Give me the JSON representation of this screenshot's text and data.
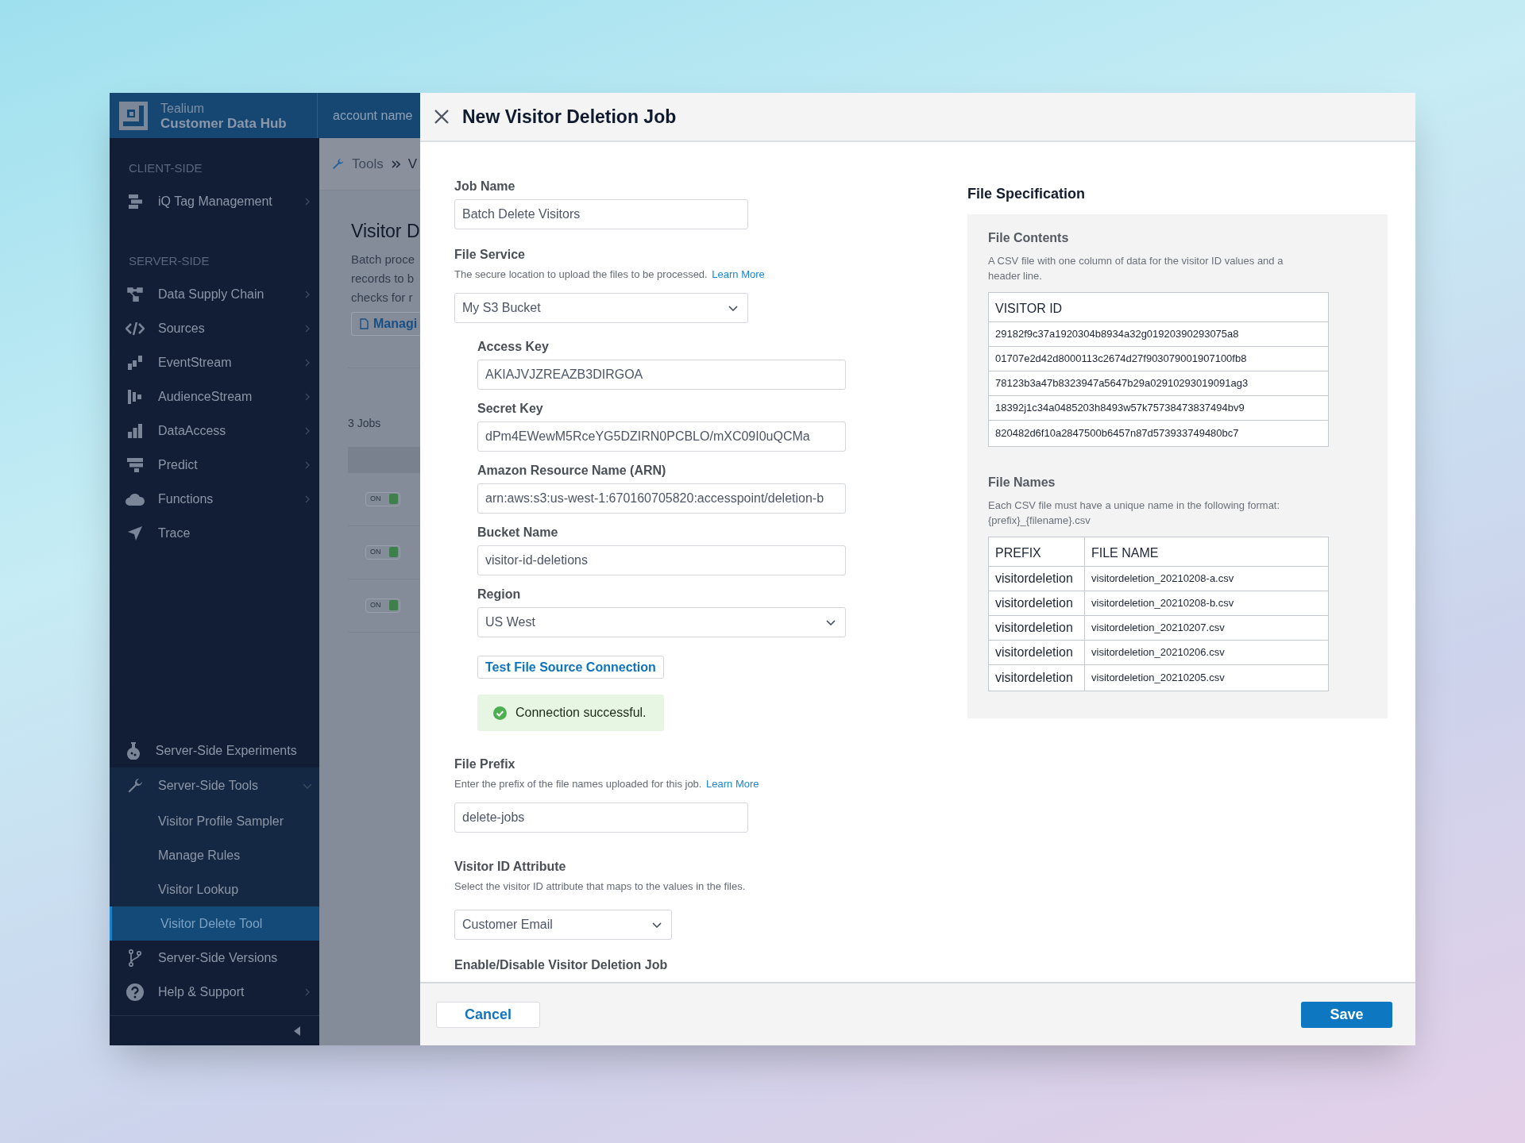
{
  "header": {
    "brand_top": "Tealium",
    "brand_bottom": "Customer Data Hub",
    "account": "account name"
  },
  "sidebar": {
    "groups": [
      {
        "heading": "CLIENT-SIDE",
        "items": [
          {
            "label": "iQ Tag Management",
            "submenu": true
          }
        ]
      },
      {
        "heading": "SERVER-SIDE",
        "items": [
          {
            "label": "Data Supply Chain",
            "submenu": true
          },
          {
            "label": "Sources",
            "submenu": true
          },
          {
            "label": "EventStream",
            "submenu": true
          },
          {
            "label": "AudienceStream",
            "submenu": true
          },
          {
            "label": "DataAccess",
            "submenu": true
          },
          {
            "label": "Predict",
            "submenu": true
          },
          {
            "label": "Functions",
            "submenu": true
          },
          {
            "label": "Trace",
            "submenu": false
          }
        ]
      },
      {
        "items": [
          {
            "label": "Server-Side Experiments",
            "submenu": false
          },
          {
            "label": "Server-Side Tools",
            "submenu": true,
            "expanded": true,
            "children": [
              {
                "label": "Visitor Profile Sampler",
                "selected": false
              },
              {
                "label": "Manage Rules",
                "selected": false
              },
              {
                "label": "Visitor Lookup",
                "selected": false
              },
              {
                "label": "Visitor Delete Tool",
                "selected": true
              }
            ]
          },
          {
            "label": "Server-Side Versions",
            "submenu": false
          },
          {
            "label": "Help & Support",
            "submenu": true
          }
        ]
      }
    ]
  },
  "page": {
    "breadcrumb": [
      "Tools",
      "V"
    ],
    "title": "Visitor D",
    "description_lines": [
      "Batch proce",
      "records to b",
      "checks for r"
    ],
    "button": "Managi",
    "job_count": "3 Jobs",
    "jobs": [
      {
        "toggle": "ON",
        "on": true
      },
      {
        "toggle": "ON",
        "on": true
      },
      {
        "toggle": "ON",
        "on": true
      }
    ]
  },
  "modal": {
    "title": "New Visitor Deletion Job",
    "fields": [
      {
        "kind": "text",
        "label": "Job Name",
        "value": "Batch Delete Visitors"
      },
      {
        "kind": "select",
        "label": "File Service",
        "help": "The secure location to upload the files to be processed.",
        "help_link": "Learn More",
        "value": "My S3 Bucket",
        "children": [
          {
            "kind": "text",
            "label": "Access Key",
            "value": "AKIAJVJZREAZB3DIRGOA"
          },
          {
            "kind": "text",
            "label": "Secret Key",
            "value": "dPm4EWewM5RceYG5DZIRN0PCBLO/mXC09I0uQCMa"
          },
          {
            "kind": "text",
            "label": "Amazon Resource Name (ARN)",
            "value": "arn:aws:s3:us-west-1:670160705820:accesspoint/deletion-b"
          },
          {
            "kind": "text",
            "label": "Bucket Name",
            "value": "visitor-id-deletions"
          },
          {
            "kind": "select",
            "label": "Region",
            "value": "US West"
          },
          {
            "kind": "button",
            "value": "Test File Source Connection"
          },
          {
            "kind": "status",
            "value": "Connection successful."
          }
        ]
      },
      {
        "kind": "text",
        "label": "File Prefix",
        "help": "Enter the prefix of the file names uploaded for this job.",
        "help_link": "Learn More",
        "value": "delete-jobs"
      },
      {
        "kind": "select",
        "label": "Visitor ID Attribute",
        "help": "Select the visitor ID attribute that maps to the values in the files.",
        "value": "Customer Email"
      },
      {
        "kind": "label",
        "label": "Enable/Disable Visitor Deletion Job"
      }
    ],
    "spec": {
      "title": "File Specification",
      "sections": [
        {
          "title": "File Contents",
          "description": "A CSV file with one column of data for the visitor ID values and a header line.",
          "columns": [
            "VISITOR ID"
          ],
          "rows": [
            [
              "29182f9c37a1920304b8934a32g01920390293075a8"
            ],
            [
              "01707e2d42d8000113c2674d27f903079001907100fb8"
            ],
            [
              "78123b3a47b8323947a5647b29a02910293019091ag3"
            ],
            [
              "18392j1c34a0485203h8493w57k75738473837494bv9"
            ],
            [
              "820482d6f10a2847500b6457n87d573933749480bc7"
            ]
          ]
        },
        {
          "title": "File Names",
          "description": "Each CSV file must have a unique name in the following format: {prefix}_{filename}.csv",
          "columns": [
            "PREFIX",
            "FILE NAME"
          ],
          "rows": [
            [
              "visitordeletion",
              "visitordeletion_20210208-a.csv"
            ],
            [
              "visitordeletion",
              "visitordeletion_20210208-b.csv"
            ],
            [
              "visitordeletion",
              "visitordeletion_20210207.csv"
            ],
            [
              "visitordeletion",
              "visitordeletion_20210206.csv"
            ],
            [
              "visitordeletion",
              "visitordeletion_20210205.csv"
            ]
          ]
        }
      ]
    },
    "footer": {
      "cancel": "Cancel",
      "save": "Save"
    }
  }
}
